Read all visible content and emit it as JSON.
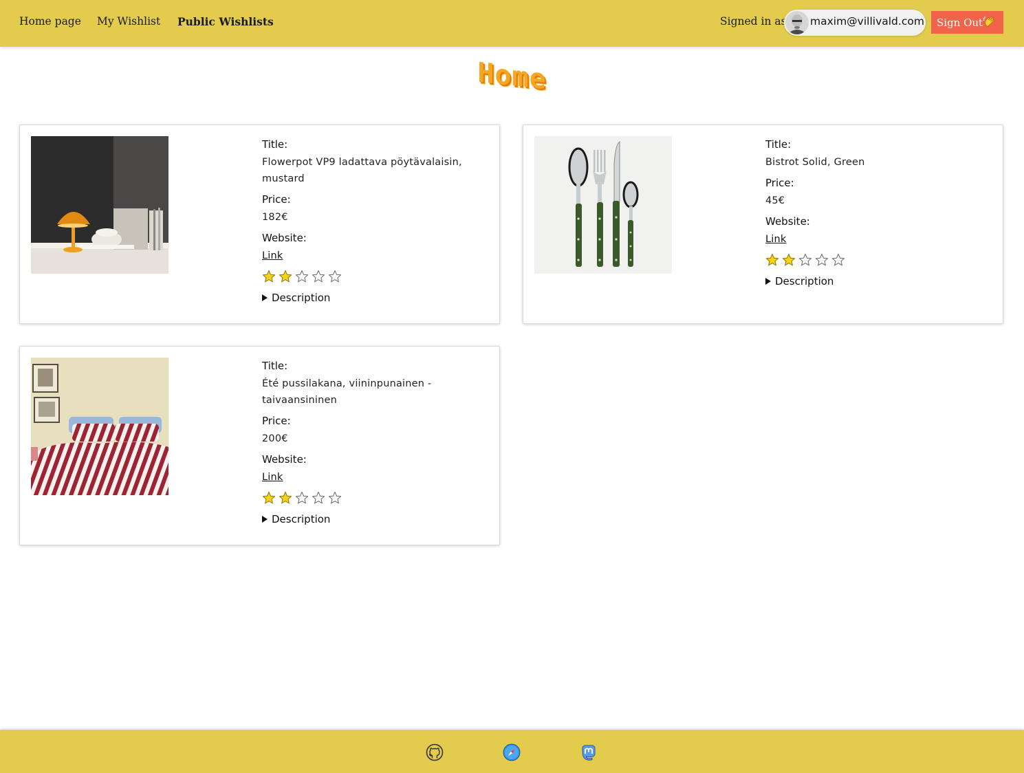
{
  "nav": {
    "home": "Home page",
    "my_wishlist": "My Wishlist",
    "public_wishlists": "Public Wishlists"
  },
  "account": {
    "signed_in_label": "Signed in as",
    "email": "maxim@villivald.com",
    "sign_out": "Sign Out"
  },
  "page": {
    "title": "Home"
  },
  "labels": {
    "title": "Title:",
    "price": "Price:",
    "website": "Website:",
    "link": "Link",
    "description": "Description"
  },
  "items": [
    {
      "title": "Flowerpot VP9 ladattava pöytävalaisin, mustard",
      "price": "182€",
      "rating": 2,
      "max_rating": 5,
      "image": "orange-table-lamp"
    },
    {
      "title": "Bistrot Solid, Green",
      "price": "45€",
      "rating": 2,
      "max_rating": 5,
      "image": "green-cutlery-set"
    },
    {
      "title": "Été pussilakana, viininpunainen - taivaansininen",
      "price": "200€",
      "rating": 2,
      "max_rating": 5,
      "image": "striped-bedding"
    }
  ],
  "footer": {
    "icons": [
      "github-icon",
      "compass-icon",
      "mastodon-icon"
    ]
  },
  "colors": {
    "header_bg": "#e2cb4d",
    "sign_out_bg": "#f26449",
    "title_orange": "#f5a623",
    "star_fill": "#f7d417"
  }
}
